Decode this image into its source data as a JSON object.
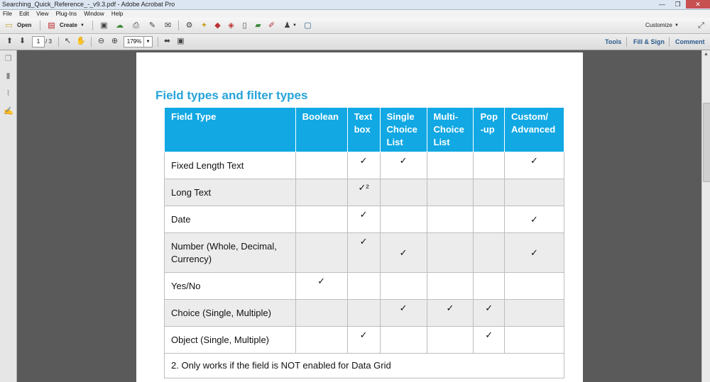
{
  "window": {
    "title": "Searching_Quick_Reference_-_v9.3.pdf - Adobe Acrobat Pro",
    "controls": [
      "—",
      "❐",
      "✕"
    ]
  },
  "menu": [
    "File",
    "Edit",
    "View",
    "Plug-Ins",
    "Window",
    "Help"
  ],
  "toolbar": {
    "open_label": "Open",
    "create_label": "Create",
    "customize_label": "Customize"
  },
  "nav": {
    "page_current": "1",
    "page_total": "/ 3",
    "zoom": "179%",
    "tools_label": "Tools",
    "fill_sign_label": "Fill & Sign",
    "comment_label": "Comment"
  },
  "document": {
    "heading": "Field types and filter types",
    "columns": [
      "Field Type",
      "Boolean",
      "Text box",
      "Single Choice List",
      "Multi-Choice List",
      "Pop -up",
      "Custom/ Advanced"
    ],
    "rows": [
      {
        "name": "Fixed Length Text",
        "cells": [
          "",
          "✓",
          "✓",
          "",
          "",
          "✓"
        ]
      },
      {
        "name": "Long Text",
        "cells": [
          "",
          "✓²",
          "",
          "",
          "",
          ""
        ]
      },
      {
        "name": "Date",
        "cells": [
          "",
          "✓",
          "",
          "",
          "",
          "✓"
        ]
      },
      {
        "name": "Number (Whole, Decimal, Currency)",
        "cells": [
          "",
          "✓",
          "✓",
          "",
          "",
          "✓"
        ]
      },
      {
        "name": "Yes/No",
        "cells": [
          "✓",
          "",
          "",
          "",
          "",
          ""
        ]
      },
      {
        "name": "Choice (Single, Multiple)",
        "cells": [
          "",
          "",
          "✓",
          "✓",
          "✓",
          ""
        ]
      },
      {
        "name": "Object (Single, Multiple)",
        "cells": [
          "",
          "✓",
          "",
          "",
          "✓",
          ""
        ]
      }
    ],
    "footnote": "2. Only works if the field is NOT enabled for Data Grid"
  }
}
